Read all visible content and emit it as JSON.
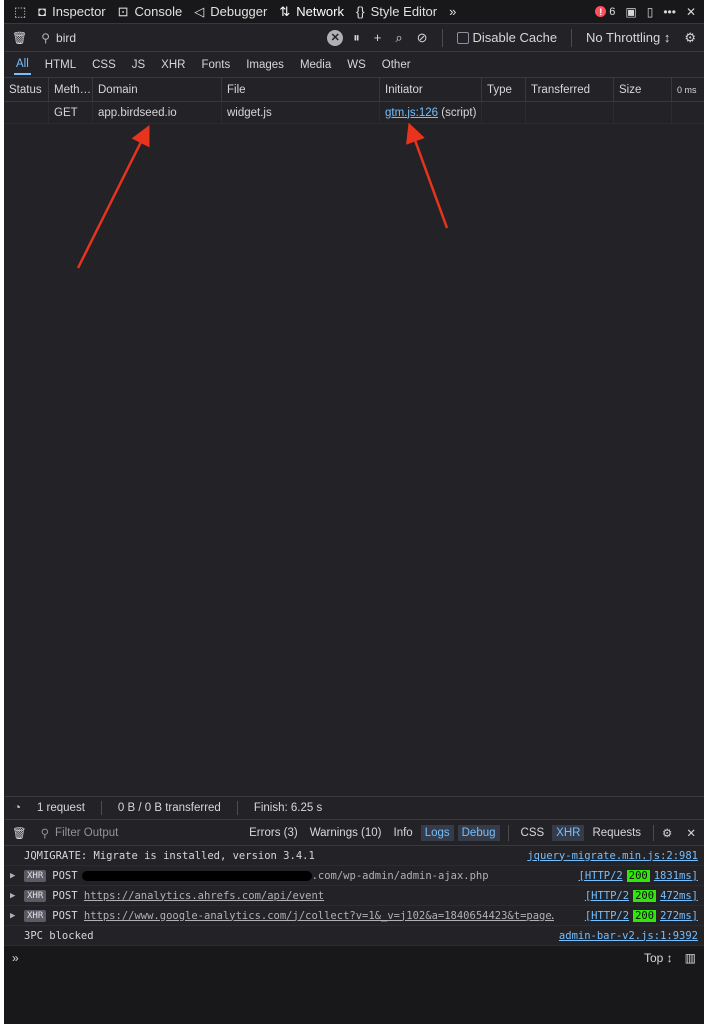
{
  "toolbar": {
    "tabs": [
      {
        "label": "Inspector",
        "icon": "inspector-icon"
      },
      {
        "label": "Console",
        "icon": "console-icon"
      },
      {
        "label": "Debugger",
        "icon": "debugger-icon"
      },
      {
        "label": "Network",
        "icon": "network-icon"
      },
      {
        "label": "Style Editor",
        "icon": "style-editor-icon"
      }
    ],
    "error_count": "6"
  },
  "filter": {
    "value": "bird",
    "disable_cache_label": "Disable Cache",
    "throttling_label": "No Throttling ↕"
  },
  "types": [
    "All",
    "HTML",
    "CSS",
    "JS",
    "XHR",
    "Fonts",
    "Images",
    "Media",
    "WS",
    "Other"
  ],
  "table": {
    "headers": [
      "Status",
      "Meth…",
      "Domain",
      "File",
      "Initiator",
      "Type",
      "Transferred",
      "Size",
      "0 ms"
    ],
    "rows": [
      {
        "status": "",
        "method": "GET",
        "domain": "app.birdseed.io",
        "file": "widget.js",
        "initiator_link": "gtm.js:126",
        "initiator_note": "(script)",
        "type": "",
        "transferred": "",
        "size": ""
      }
    ]
  },
  "status": {
    "requests": "1 request",
    "transferred": "0 B / 0 B transferred",
    "finish": "Finish: 6.25 s"
  },
  "console": {
    "filter_placeholder": "Filter Output",
    "buttons": [
      "Errors (3)",
      "Warnings (10)",
      "Info",
      "Logs",
      "Debug"
    ],
    "buttons2": [
      "CSS",
      "XHR",
      "Requests"
    ],
    "messages": [
      {
        "text": "JQMIGRATE: Migrate is installed, version 3.4.1",
        "source": "jquery-migrate.min.js:2:981"
      },
      {
        "method": "POST",
        "url": ".com/wp-admin/admin-ajax.php",
        "proto": "[HTTP/2",
        "code": "200",
        "time": "1831ms]"
      },
      {
        "method": "POST",
        "url": "https://analytics.ahrefs.com/api/event",
        "proto": "[HTTP/2",
        "code": "200",
        "time": "472ms]"
      },
      {
        "method": "POST",
        "url": "https://www.google-analytics.com/j/collect?v=1&_v=j102&a=1840654423&t=page…",
        "proto": "[HTTP/2",
        "code": "200",
        "time": "272ms]"
      },
      {
        "text": "3PC blocked",
        "source": "admin-bar-v2.js:1:9392"
      }
    ],
    "xhr_badge": "XHR",
    "prompt": "»",
    "context": "Top ↕"
  }
}
